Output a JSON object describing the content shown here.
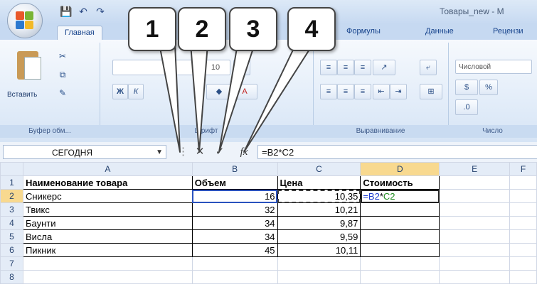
{
  "window": {
    "title": "Товары_new - M"
  },
  "tabs": [
    {
      "label": "Главная",
      "active": true
    },
    {
      "label": "Формулы"
    },
    {
      "label": "Данные"
    },
    {
      "label": "Рецензи"
    }
  ],
  "ribbon": {
    "clipboard": {
      "paste_label": "Вставить",
      "group_label": "Буфер обм..."
    },
    "font": {
      "group_label": "Шрифт",
      "bold": "Ж",
      "italic": "К",
      "size": "10"
    },
    "alignment": {
      "group_label": "Выравнивание"
    },
    "number": {
      "group_label": "Число",
      "format": "Числовой"
    }
  },
  "formula_bar": {
    "name_box": "СЕГОДНЯ",
    "cancel_glyph": "✕",
    "enter_glyph": "✓",
    "fx_glyph": "fx",
    "formula": "=B2*C2"
  },
  "sheet": {
    "columns": [
      "A",
      "B",
      "C",
      "D",
      "E",
      "F"
    ],
    "rows": [
      {
        "n": "1",
        "cells": [
          "Наименование товара",
          "Объем",
          "Цена",
          "Стоимость",
          "",
          ""
        ]
      },
      {
        "n": "2",
        "cells": [
          "Сникерс",
          "16",
          "10,35",
          "",
          "",
          ""
        ]
      },
      {
        "n": "3",
        "cells": [
          "Твикс",
          "32",
          "10,21",
          "",
          "",
          ""
        ]
      },
      {
        "n": "4",
        "cells": [
          "Баунти",
          "34",
          "9,87",
          "",
          "",
          ""
        ]
      },
      {
        "n": "5",
        "cells": [
          "Висла",
          "34",
          "9,59",
          "",
          "",
          ""
        ]
      },
      {
        "n": "6",
        "cells": [
          "Пикник",
          "45",
          "10,11",
          "",
          "",
          ""
        ]
      },
      {
        "n": "7",
        "cells": [
          "",
          "",
          "",
          "",
          "",
          ""
        ]
      },
      {
        "n": "8",
        "cells": [
          "",
          "",
          "",
          "",
          "",
          ""
        ]
      }
    ],
    "editing_cell": {
      "ref_b": "=B2",
      "op": "*",
      "ref_c": "C2"
    }
  },
  "callouts": [
    "1",
    "2",
    "3",
    "4"
  ],
  "colors": {
    "ref_b": "#1c3ccf",
    "ref_c": "#1d8a1d",
    "selected_header": "#f8d98f"
  }
}
